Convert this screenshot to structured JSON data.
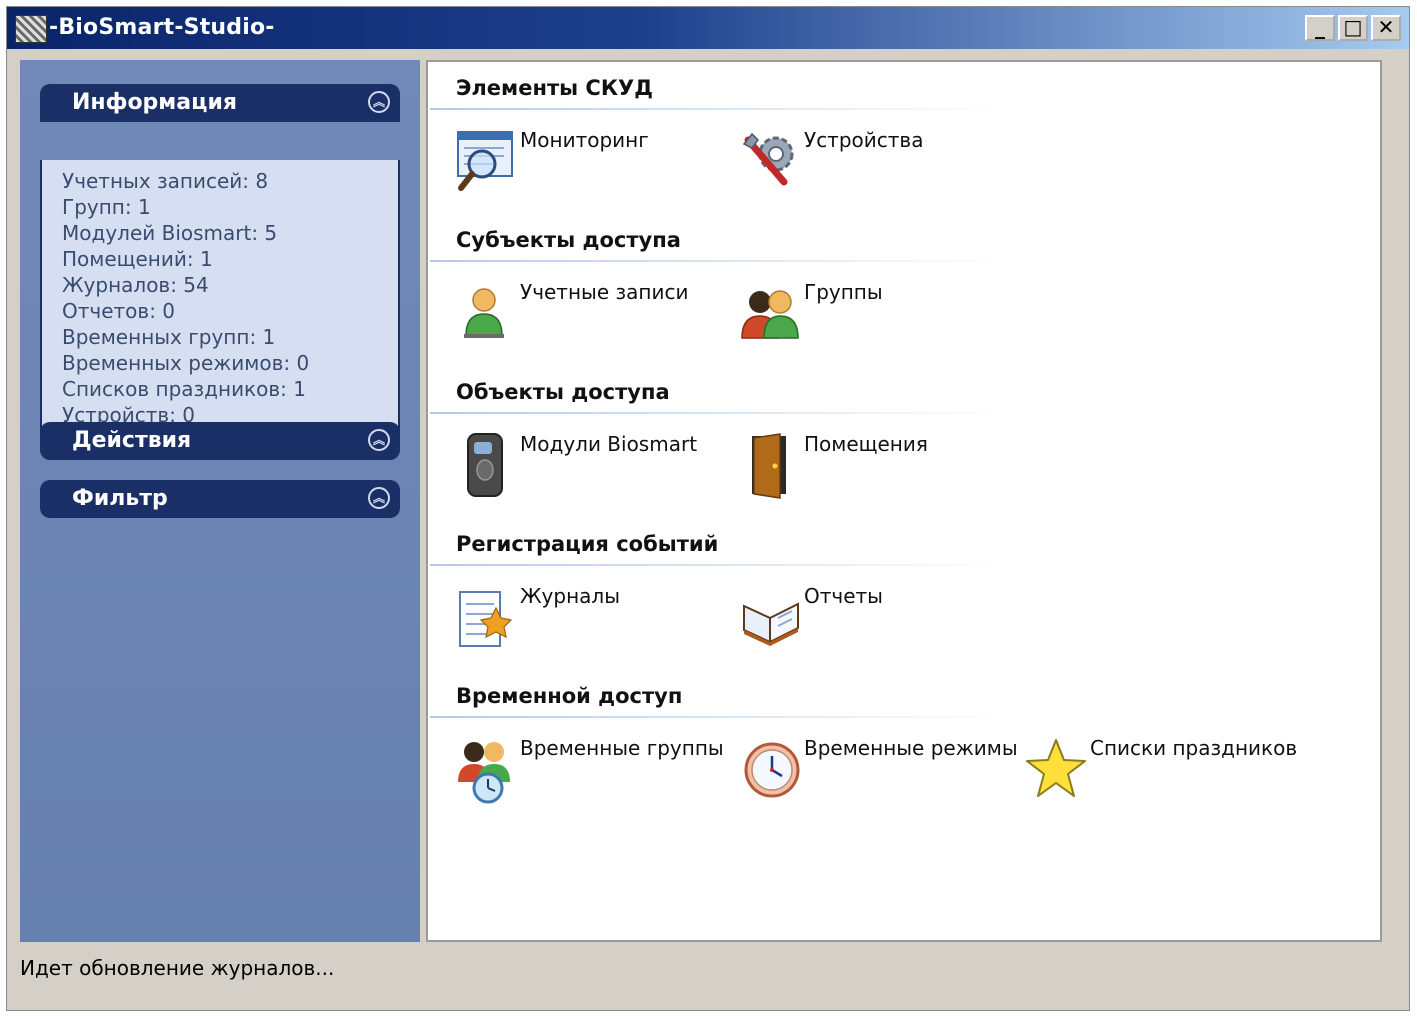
{
  "window": {
    "title": "-BioSmart-Studio-",
    "buttons": {
      "minimize": "_",
      "maximize": "□",
      "close": "✕"
    }
  },
  "sidebar": {
    "info": {
      "title": "Информация",
      "lines": [
        "Учетных записей: 8",
        "Групп: 1",
        "Модулей Biosmart: 5",
        "Помещений: 1",
        "Журналов: 54",
        "Отчетов: 0",
        "Временных групп: 1",
        "Временных режимов: 0",
        "Списков праздников: 1",
        "Устройств: 0"
      ]
    },
    "actions": {
      "title": "Действия"
    },
    "filter": {
      "title": "Фильтр"
    }
  },
  "sections": [
    {
      "title": "Элементы СКУД",
      "items": [
        {
          "label": "Мониторинг",
          "icon": "monitoring-icon"
        },
        {
          "label": "Устройства",
          "icon": "devices-icon"
        }
      ]
    },
    {
      "title": "Субъекты доступа",
      "items": [
        {
          "label": "Учетные записи",
          "icon": "user-icon"
        },
        {
          "label": "Группы",
          "icon": "group-icon"
        }
      ]
    },
    {
      "title": "Объекты доступа",
      "items": [
        {
          "label": "Модули Biosmart",
          "icon": "biosmart-module-icon"
        },
        {
          "label": "Помещения",
          "icon": "door-icon"
        }
      ]
    },
    {
      "title": "Регистрация событий",
      "items": [
        {
          "label": "Журналы",
          "icon": "journal-icon"
        },
        {
          "label": "Отчеты",
          "icon": "report-book-icon"
        }
      ]
    },
    {
      "title": "Временной доступ",
      "items": [
        {
          "label": "Временные группы",
          "icon": "time-group-icon"
        },
        {
          "label": "Временные режимы",
          "icon": "clock-icon"
        },
        {
          "label": "Списки праздников",
          "icon": "star-icon"
        }
      ]
    }
  ],
  "status": {
    "text": "Идет обновление журналов..."
  }
}
